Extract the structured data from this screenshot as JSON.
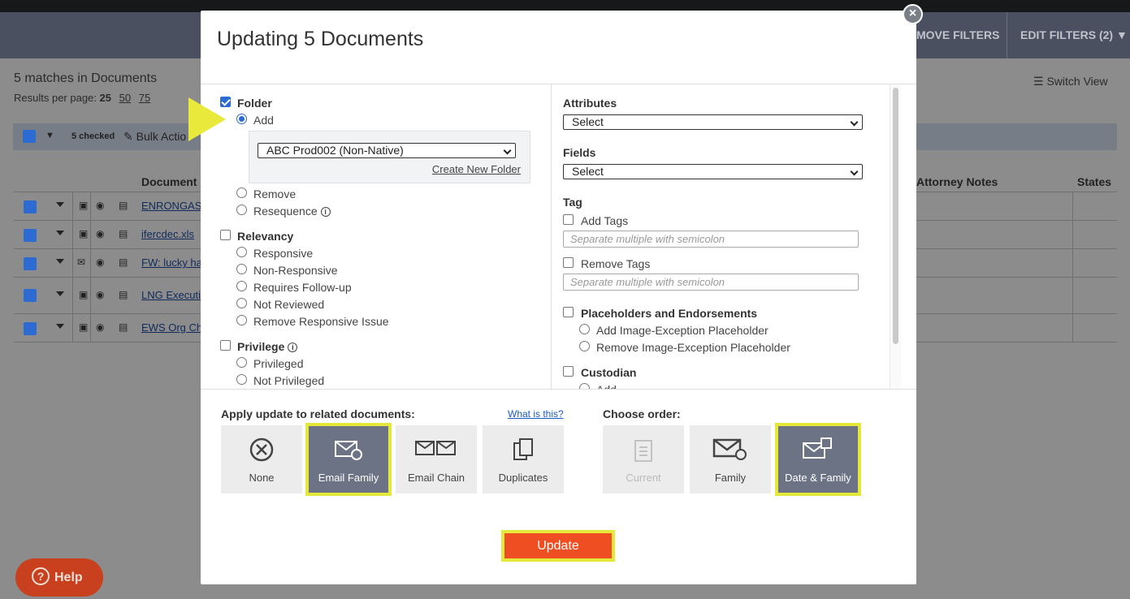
{
  "background": {
    "remove_filters": "MOVE FILTERS",
    "edit_filters": "EDIT FILTERS (2) ▼",
    "matches": "5 matches in Documents",
    "per_page_label": "Results per page:",
    "per_page_options": [
      "25",
      "50",
      "75"
    ],
    "switch_view": "Switch View",
    "checked_count": "5 checked",
    "bulk_actions": "Bulk Actio",
    "columns": {
      "document": "Document",
      "attorney_notes": "Attorney Notes",
      "states": "States"
    },
    "rows": [
      {
        "name": "ENRONGAS(",
        "icon": "excel-icon"
      },
      {
        "name": "ifercdec.xls",
        "icon": "excel-icon"
      },
      {
        "name": "FW: lucky ha",
        "icon": "email-icon"
      },
      {
        "name": "LNG Executiv",
        "icon": "word-icon"
      },
      {
        "name": "EWS Org Cha",
        "icon": "pdf-icon"
      }
    ],
    "help": "Help"
  },
  "modal": {
    "title": "Updating 5 Documents",
    "folder": {
      "label": "Folder",
      "add": "Add",
      "selected_folder": "ABC Prod002 (Non-Native)",
      "create_new": "Create New Folder",
      "remove": "Remove",
      "resequence": "Resequence"
    },
    "relevancy": {
      "label": "Relevancy",
      "options": [
        "Responsive",
        "Non-Responsive",
        "Requires Follow-up",
        "Not Reviewed",
        "Remove Responsive Issue"
      ]
    },
    "privilege": {
      "label": "Privilege",
      "options": [
        "Privileged",
        "Not Privileged"
      ]
    },
    "attributes": {
      "label": "Attributes",
      "value": "Select"
    },
    "fields": {
      "label": "Fields",
      "value": "Select"
    },
    "tag": {
      "label": "Tag",
      "add_tags": "Add Tags",
      "remove_tags": "Remove Tags",
      "placeholder": "Separate multiple with semicolon"
    },
    "placeholders": {
      "label": "Placeholders and Endorsements",
      "add": "Add Image-Exception Placeholder",
      "remove": "Remove Image-Exception Placeholder"
    },
    "custodian": {
      "label": "Custodian",
      "add": "Add"
    },
    "related": {
      "label": "Apply update to related documents:",
      "what_is_this": "What is this?",
      "tiles": [
        "None",
        "Email Family",
        "Email Chain",
        "Duplicates"
      ]
    },
    "order": {
      "label": "Choose order:",
      "tiles": [
        "Current",
        "Family",
        "Date & Family"
      ]
    },
    "update": "Update"
  },
  "colors": {
    "accent": "#2c6bd2",
    "update": "#ee4e22",
    "highlight": "#e3e83a",
    "selected_tile": "#6b7384"
  }
}
